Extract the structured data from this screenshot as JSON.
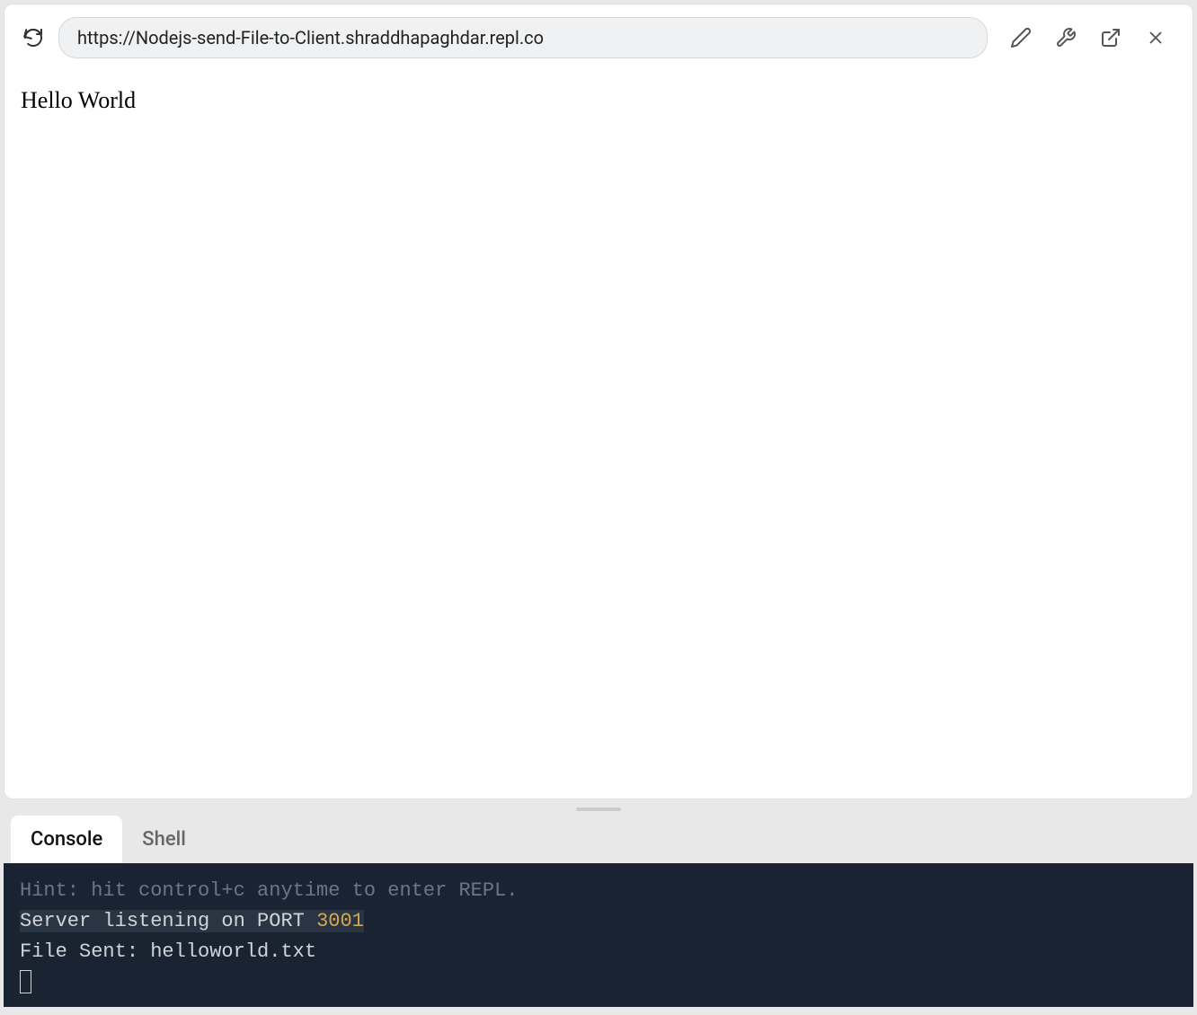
{
  "toolbar": {
    "url": "https://Nodejs-send-File-to-Client.shraddhapaghdar.repl.co"
  },
  "page": {
    "content": "Hello World"
  },
  "tabs": {
    "console": "Console",
    "shell": "Shell"
  },
  "console": {
    "hint": "Hint: hit control+c anytime to enter REPL.",
    "line2_prefix": "Server listening on PORT ",
    "line2_port": "3001",
    "line3": "File Sent: helloworld.txt"
  }
}
